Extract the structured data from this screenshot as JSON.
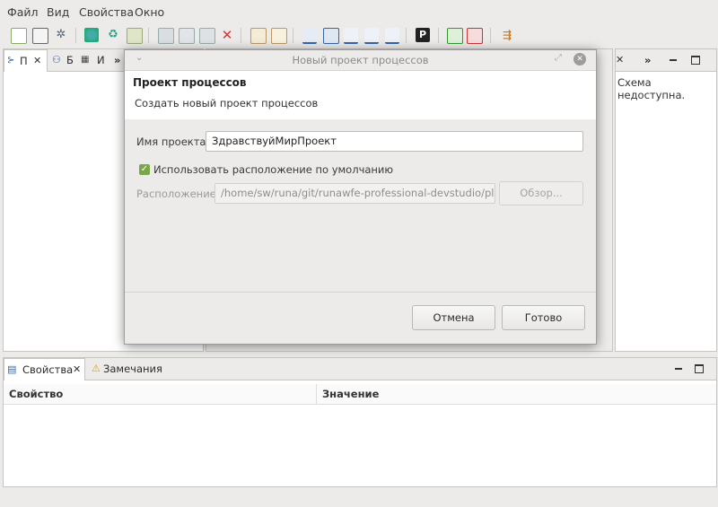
{
  "menubar": [
    "Файл",
    "Вид",
    "Свойства",
    "Окно"
  ],
  "toolbar": {
    "icons": [
      "new-project-icon",
      "layout-icon",
      "settings-icon",
      "bot-icon",
      "recycle-icon",
      "edit-icon",
      "save-icon",
      "save-all-icon",
      "export-icon",
      "delete-icon",
      "import-icon",
      "upload-icon",
      "deploy-icon",
      "sync-icon",
      "stats-icon",
      "chart-icon",
      "p-icon",
      "refresh-green-icon",
      "close-red-icon",
      "run-icon"
    ]
  },
  "left_view": {
    "tab1": "П",
    "tab2": "Б",
    "tab3": "И",
    "more": "»"
  },
  "right_view": {
    "more": "»",
    "message": "Схема недоступна."
  },
  "dialog": {
    "title": "Новый проект процессов",
    "header_title": "Проект процессов",
    "header_desc": "Создать новый проект процессов",
    "project_name_label": "Имя проекта:",
    "project_name_value": "ЗдравствуйМирПроект",
    "use_default_label": "Использовать расположение по умолчанию",
    "use_default_checked": true,
    "location_label": "Расположение:",
    "location_value": "/home/sw/runa/git/runawfe-professional-devstudio/plug",
    "browse_label": "Обзор...",
    "cancel_label": "Отмена",
    "finish_label": "Готово"
  },
  "bottom": {
    "tab_properties": "Свойства",
    "tab_problems": "Замечания",
    "col_property": "Свойство",
    "col_value": "Значение"
  },
  "colors": {
    "accent": "#7aa64a",
    "background": "#ecebe9"
  }
}
